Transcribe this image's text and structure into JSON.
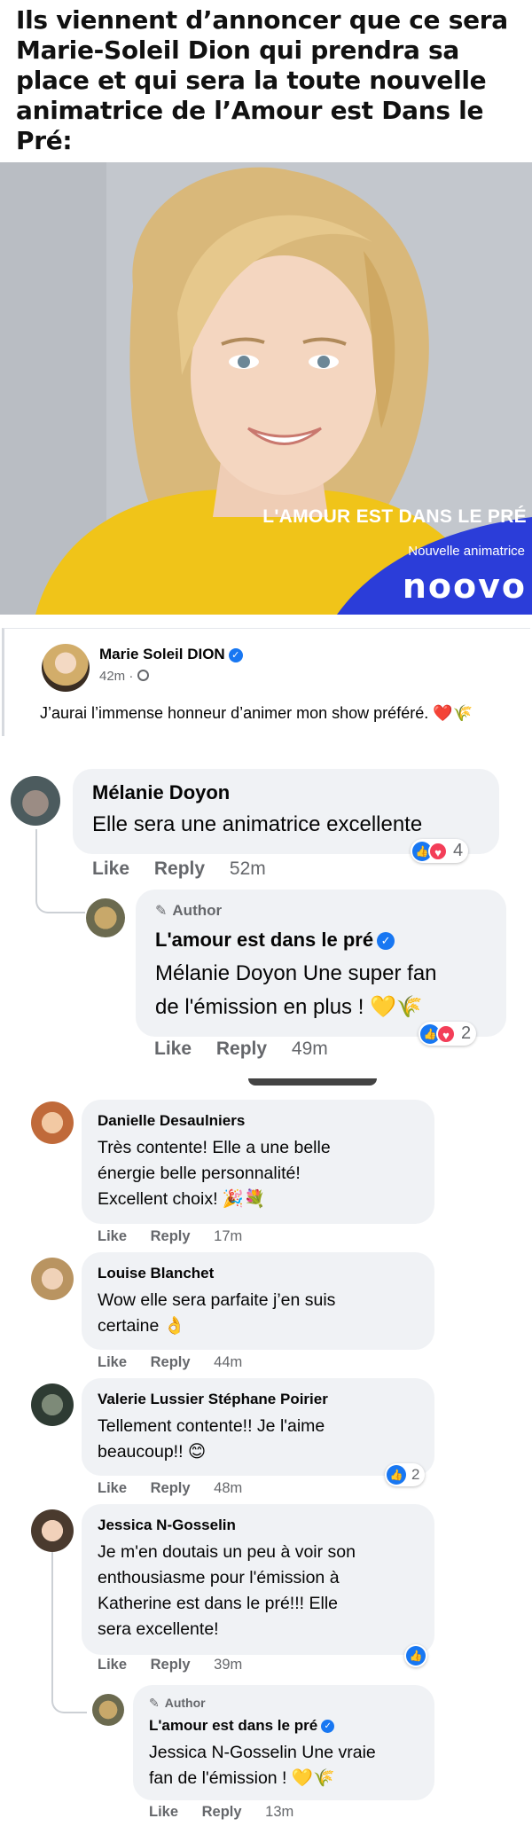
{
  "headline": "Ils viennent d’annoncer que ce sera Marie-Soleil Dion qui prendra sa place et qui sera la toute nouvelle animatrice de l’Amour est Dans le Pré:",
  "hero": {
    "show_title": "L'AMOUR EST DANS LE PRÉ",
    "subtitle": "Nouvelle animatrice",
    "brand": "noovo",
    "accent_color": "#2b3dd9"
  },
  "post": {
    "author": "Marie Soleil DION",
    "time": "42m ·",
    "text": "J’aurai l’immense honneur d’animer mon show préféré. ❤️🌾"
  },
  "comments_top": [
    {
      "author": "Mélanie Doyon",
      "text": "Elle sera une animatrice excellente",
      "like_label": "Like",
      "reply_label": "Reply",
      "time": "52m",
      "reaction_count": "4",
      "replies": [
        {
          "tag": "Author",
          "author": "L'amour est dans le pré",
          "text_lines": [
            "Mélanie Doyon Une super fan",
            "de l'émission en plus ! 💛🌾"
          ],
          "like_label": "Like",
          "reply_label": "Reply",
          "time": "49m",
          "reaction_count": "2"
        }
      ]
    }
  ],
  "comments": [
    {
      "author": "Danielle Desaulniers",
      "text_lines": [
        "Très contente! Elle a une belle",
        "énergie belle personnalité!",
        "Excellent choix! 🎉💐"
      ],
      "like_label": "Like",
      "reply_label": "Reply",
      "time": "17m"
    },
    {
      "author": "Louise Blanchet",
      "text_lines": [
        "Wow elle sera parfaite j’en suis",
        "certaine 👌"
      ],
      "like_label": "Like",
      "reply_label": "Reply",
      "time": "44m"
    },
    {
      "author": "Valerie Lussier Stéphane Poirier",
      "text_lines": [
        "Tellement contente!! Je l'aime",
        "beaucoup!! 😊"
      ],
      "like_label": "Like",
      "reply_label": "Reply",
      "time": "48m",
      "reaction_count": "2"
    },
    {
      "author": "Jessica N-Gosselin",
      "text_lines": [
        "Je m'en doutais un peu à voir son",
        "enthousiasme pour l'émission à",
        "Katherine est dans le pré!!! Elle",
        "sera excellente!"
      ],
      "like_label": "Like",
      "reply_label": "Reply",
      "time": "39m",
      "reply": {
        "tag": "Author",
        "author": "L'amour est dans le pré",
        "text_lines": [
          "Jessica N-Gosselin Une vraie",
          "fan de l'émission ! 💛🌾"
        ],
        "like_label": "Like",
        "reply_label": "Reply",
        "time": "13m"
      }
    }
  ]
}
